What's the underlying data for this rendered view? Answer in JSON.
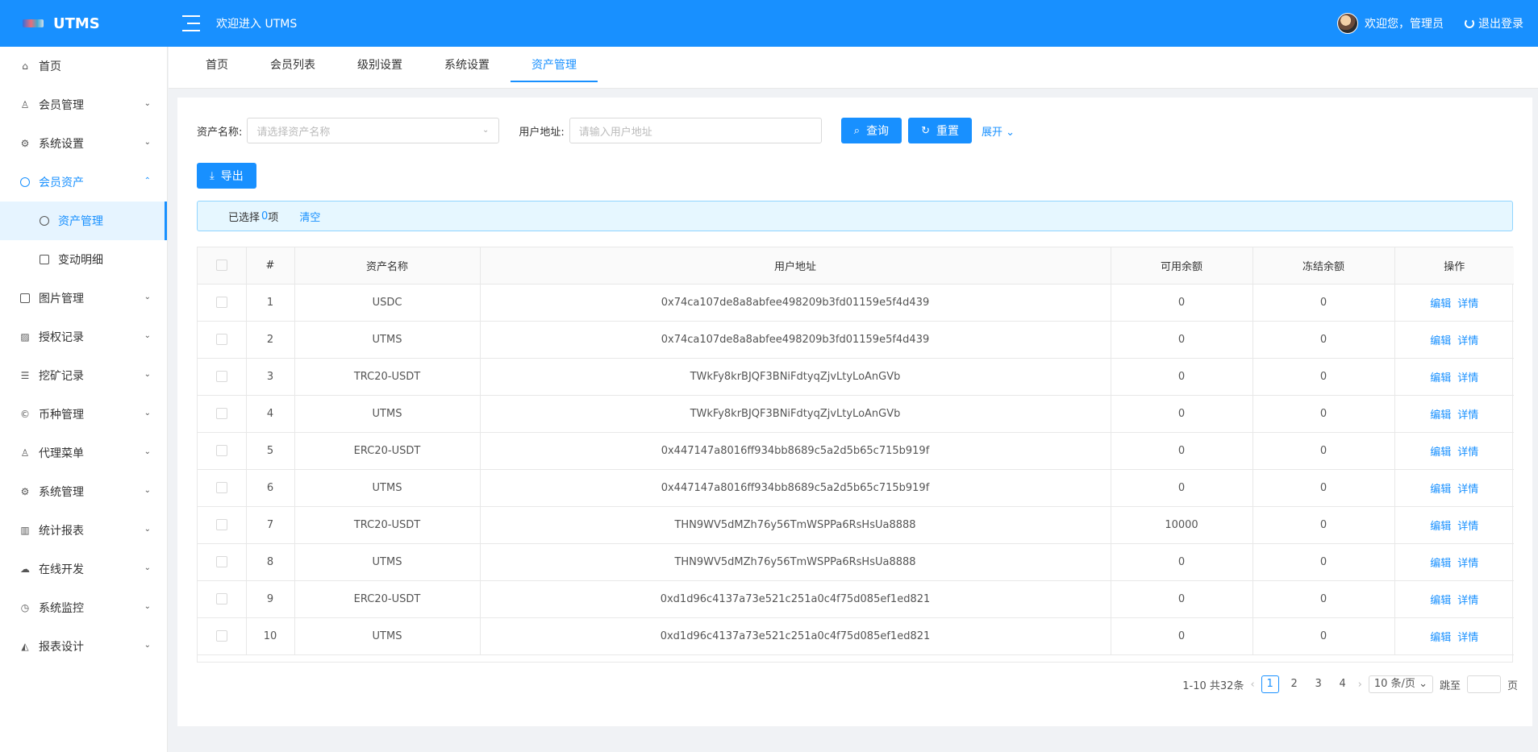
{
  "header": {
    "app_name": "UTMS",
    "welcome": "欢迎进入 UTMS",
    "user_greeting": "欢迎您，管理员",
    "logout": "退出登录"
  },
  "sidebar": {
    "items": [
      {
        "label": "首页",
        "icon": "home-icon"
      },
      {
        "label": "会员管理",
        "icon": "user-icon"
      },
      {
        "label": "系统设置",
        "icon": "gear-icon"
      },
      {
        "label": "会员资产",
        "icon": "coin-icon"
      },
      {
        "label": "资产管理",
        "icon": "coin-icon"
      },
      {
        "label": "变动明细",
        "icon": "doc-icon"
      },
      {
        "label": "图片管理",
        "icon": "image-icon"
      },
      {
        "label": "授权记录",
        "icon": "picture-icon"
      },
      {
        "label": "挖矿记录",
        "icon": "list-icon"
      },
      {
        "label": "币种管理",
        "icon": "copyright-icon"
      },
      {
        "label": "代理菜单",
        "icon": "user-icon"
      },
      {
        "label": "系统管理",
        "icon": "gear-icon"
      },
      {
        "label": "统计报表",
        "icon": "bar-chart-icon"
      },
      {
        "label": "在线开发",
        "icon": "cloud-icon"
      },
      {
        "label": "系统监控",
        "icon": "dashboard-icon"
      },
      {
        "label": "报表设计",
        "icon": "area-chart-icon"
      }
    ]
  },
  "tabs": [
    {
      "label": "首页"
    },
    {
      "label": "会员列表"
    },
    {
      "label": "级别设置"
    },
    {
      "label": "系统设置"
    },
    {
      "label": "资产管理"
    }
  ],
  "search": {
    "asset_label": "资产名称:",
    "asset_placeholder": "请选择资产名称",
    "address_label": "用户地址:",
    "address_placeholder": "请输入用户地址",
    "query": "查询",
    "reset": "重置",
    "expand": "展开"
  },
  "toolbar": {
    "export": "导出"
  },
  "selection": {
    "prefix": "已选择",
    "count": "0",
    "suffix": "项",
    "clear": "清空"
  },
  "table": {
    "headers": [
      "#",
      "资产名称",
      "用户地址",
      "可用余额",
      "冻结余额",
      "操作"
    ],
    "rows": [
      {
        "no": "1",
        "asset": "USDC",
        "address": "0x74ca107de8a8abfee498209b3fd01159e5f4d439",
        "available": "0",
        "frozen": "0"
      },
      {
        "no": "2",
        "asset": "UTMS",
        "address": "0x74ca107de8a8abfee498209b3fd01159e5f4d439",
        "available": "0",
        "frozen": "0"
      },
      {
        "no": "3",
        "asset": "TRC20-USDT",
        "address": "TWkFy8krBJQF3BNiFdtyqZjvLtyLoAnGVb",
        "available": "0",
        "frozen": "0"
      },
      {
        "no": "4",
        "asset": "UTMS",
        "address": "TWkFy8krBJQF3BNiFdtyqZjvLtyLoAnGVb",
        "available": "0",
        "frozen": "0"
      },
      {
        "no": "5",
        "asset": "ERC20-USDT",
        "address": "0x447147a8016ff934bb8689c5a2d5b65c715b919f",
        "available": "0",
        "frozen": "0"
      },
      {
        "no": "6",
        "asset": "UTMS",
        "address": "0x447147a8016ff934bb8689c5a2d5b65c715b919f",
        "available": "0",
        "frozen": "0"
      },
      {
        "no": "7",
        "asset": "TRC20-USDT",
        "address": "THN9WV5dMZh76y56TmWSPPa6RsHsUa8888",
        "available": "10000",
        "frozen": "0"
      },
      {
        "no": "8",
        "asset": "UTMS",
        "address": "THN9WV5dMZh76y56TmWSPPa6RsHsUa8888",
        "available": "0",
        "frozen": "0"
      },
      {
        "no": "9",
        "asset": "ERC20-USDT",
        "address": "0xd1d96c4137a73e521c251a0c4f75d085ef1ed821",
        "available": "0",
        "frozen": "0"
      },
      {
        "no": "10",
        "asset": "UTMS",
        "address": "0xd1d96c4137a73e521c251a0c4f75d085ef1ed821",
        "available": "0",
        "frozen": "0"
      }
    ],
    "edit": "编辑",
    "detail": "详情"
  },
  "pagination": {
    "summary": "1-10 共32条",
    "pages": [
      "1",
      "2",
      "3",
      "4"
    ],
    "page_size": "10 条/页",
    "jump": "跳至",
    "page_unit": "页"
  },
  "colors": {
    "primary": "#1890ff"
  }
}
